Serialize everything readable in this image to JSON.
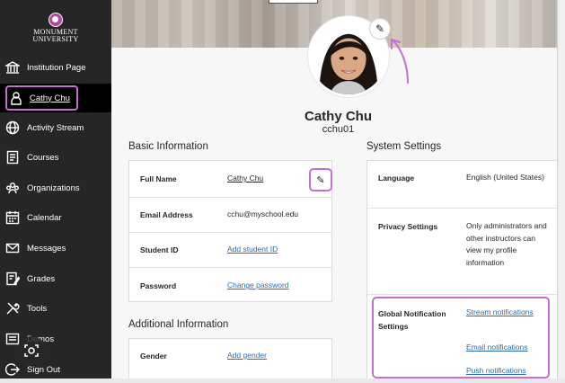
{
  "brand": {
    "logo_line1": "MONUMENT",
    "logo_line2": "UNIVERSITY",
    "accent_color": "#c56fd1"
  },
  "sidebar": {
    "items": [
      {
        "label": "Institution Page",
        "icon": "institution-icon"
      },
      {
        "label": "Cathy Chu",
        "icon": "user-icon",
        "active": true
      },
      {
        "label": "Activity Stream",
        "icon": "globe-icon"
      },
      {
        "label": "Courses",
        "icon": "courses-icon"
      },
      {
        "label": "Organizations",
        "icon": "organizations-icon"
      },
      {
        "label": "Calendar",
        "icon": "calendar-icon"
      },
      {
        "label": "Messages",
        "icon": "envelope-icon"
      },
      {
        "label": "Grades",
        "icon": "grades-icon"
      },
      {
        "label": "Tools",
        "icon": "tools-icon"
      },
      {
        "label": "Demos",
        "icon": "demos-icon"
      },
      {
        "label": "Sign Out",
        "icon": "sign-out-icon"
      }
    ]
  },
  "profile": {
    "name": "Cathy Chu",
    "username": "cchu01",
    "avatar_edit_icon": "pencil-icon"
  },
  "basic_info": {
    "title": "Basic Information",
    "rows": [
      {
        "label": "Full Name",
        "value": "Cathy Chu"
      },
      {
        "label": "Email Address",
        "value": "cchu@myschool.edu"
      },
      {
        "label": "Student ID",
        "value": "Add student ID"
      },
      {
        "label": "Password",
        "value": "Change password"
      }
    ],
    "edit_icon": "pencil-icon"
  },
  "additional_info": {
    "title": "Additional Information",
    "rows": [
      {
        "label": "Gender",
        "value": "Add gender"
      }
    ]
  },
  "system_settings": {
    "title": "System Settings",
    "language": {
      "label": "Language",
      "value": "English (United States)"
    },
    "privacy": {
      "label": "Privacy Settings",
      "value": "Only administrators and other instructors can view my profile information"
    },
    "notifications": {
      "label": "Global Notification Settings",
      "links": [
        "Stream notifications",
        "Email notifications",
        "Push notifications"
      ]
    }
  }
}
